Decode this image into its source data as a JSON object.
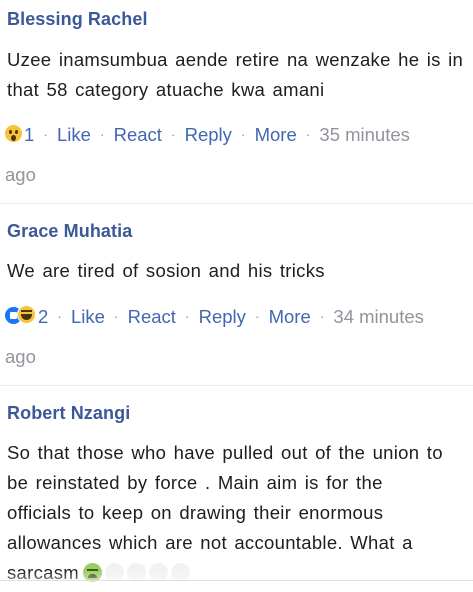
{
  "comments": [
    {
      "author": "Blessing Rachel",
      "text": "Uzee inamsumbua aende retire na wenzake he is in that 58 category atuache kwa amani",
      "reaction_count": "1",
      "like": "Like",
      "react": "React",
      "reply": "Reply",
      "more": "More",
      "time_part1": "35 minutes",
      "time_part2": "ago",
      "reaction_icons": [
        "wow-icon"
      ]
    },
    {
      "author": "Grace Muhatia",
      "text": "We are tired of sosion and his tricks",
      "reaction_count": "2",
      "like": "Like",
      "react": "React",
      "reply": "Reply",
      "more": "More",
      "time_part1": "34 minutes",
      "time_part2": "ago",
      "reaction_icons": [
        "like-icon",
        "haha-icon"
      ]
    },
    {
      "author": "Robert Nzangi",
      "text_lines": [
        "So that those who have pulled out of the union to",
        "be reinstated by force . Main aim is for the",
        "officials to keep on drawing their enormous",
        "allowances which are not accountable. What a",
        "sarcasm"
      ],
      "trailing_emoji": "nauseated-face-icon"
    }
  ],
  "colors": {
    "author": "#3b5998",
    "link": "#4267b2",
    "meta": "#90949c",
    "text": "#1c1e21"
  }
}
